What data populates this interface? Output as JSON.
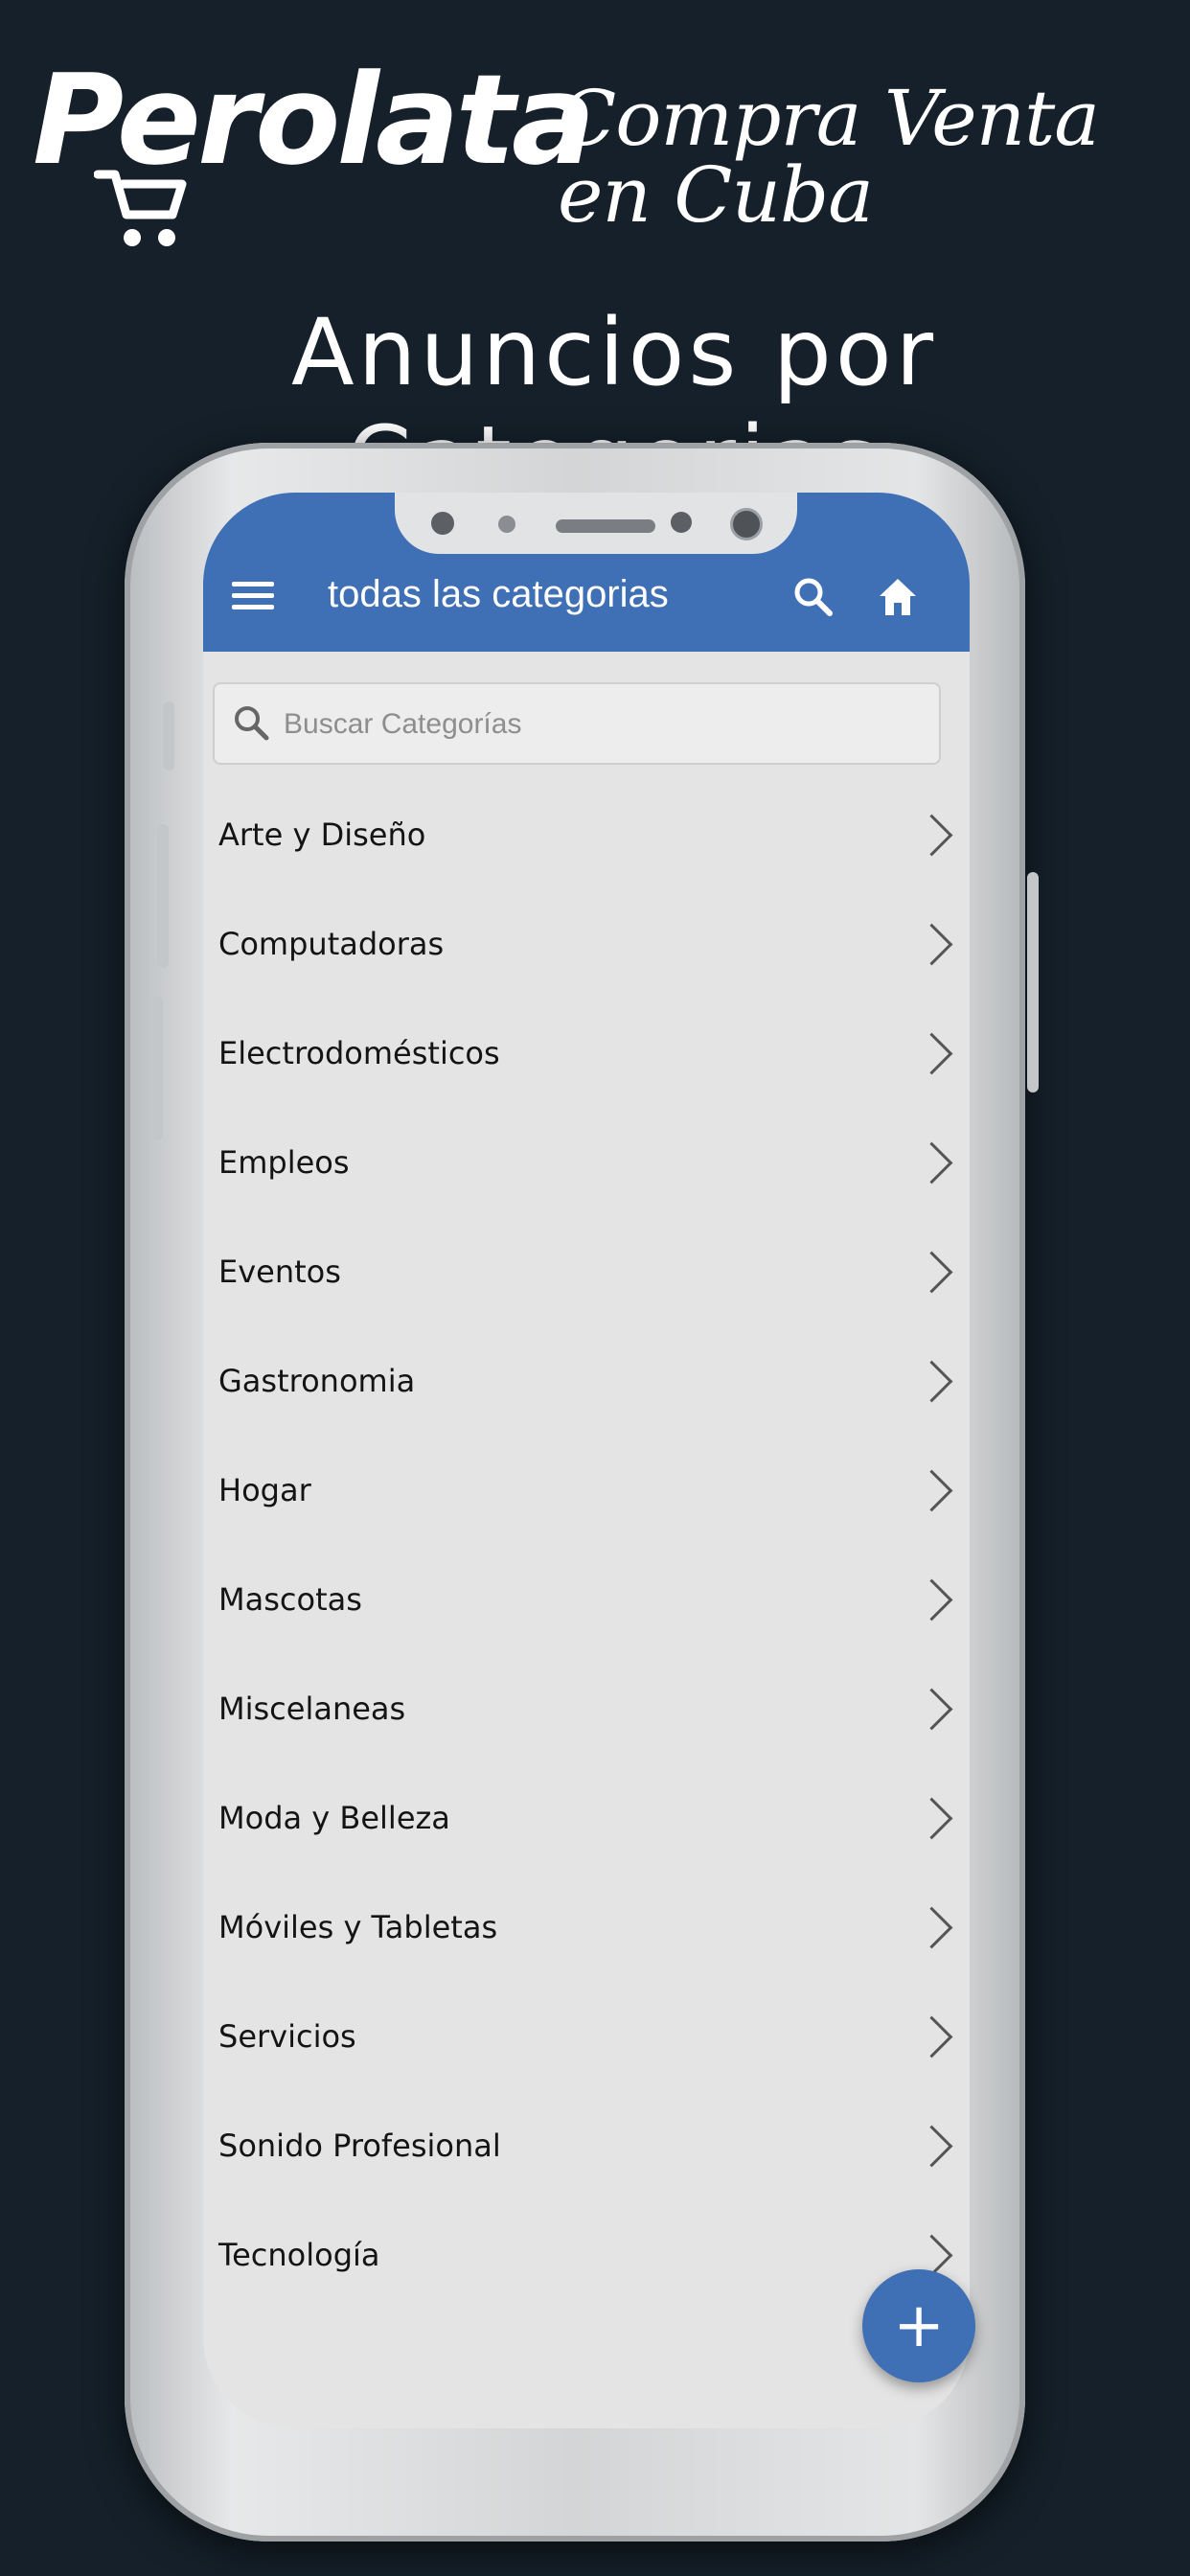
{
  "brand": {
    "logo_text": "Perolata",
    "tagline": "Compra Venta en Cuba"
  },
  "headline": "Anuncios por Categorias",
  "colors": {
    "background": "#15202a",
    "appbar": "#3f6fb4",
    "fab": "#3f6fb4",
    "screen": "#e4e4e4"
  },
  "appbar": {
    "title": "todas las categorias",
    "menu_icon": "hamburger-menu-icon",
    "search_icon": "search-icon",
    "home_icon": "home-icon"
  },
  "search": {
    "placeholder": "Buscar Categorías",
    "value": ""
  },
  "categories": [
    {
      "label": "Arte y Diseño"
    },
    {
      "label": "Computadoras"
    },
    {
      "label": "Electrodomésticos"
    },
    {
      "label": "Empleos"
    },
    {
      "label": "Eventos"
    },
    {
      "label": "Gastronomia"
    },
    {
      "label": "Hogar"
    },
    {
      "label": "Mascotas"
    },
    {
      "label": "Miscelaneas"
    },
    {
      "label": "Moda y Belleza"
    },
    {
      "label": "Móviles y Tabletas"
    },
    {
      "label": "Servicios"
    },
    {
      "label": "Sonido Profesional"
    },
    {
      "label": "Tecnología"
    }
  ],
  "fab": {
    "label": "+",
    "icon": "plus-icon"
  }
}
